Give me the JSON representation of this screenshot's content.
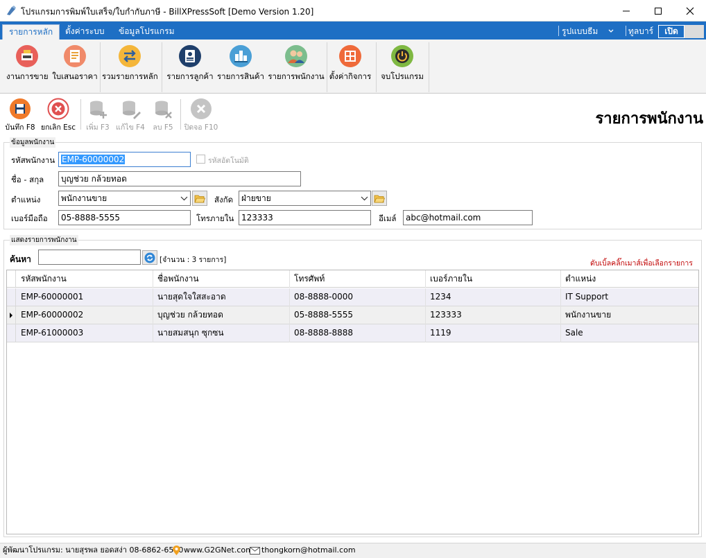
{
  "window": {
    "title": "โปรแกรมการพิมพ์ใบเสร็จ/ใบกำกับภาษี - BillXPressSoft [Demo Version 1.20]",
    "minimize_icon": "minimize-icon",
    "maximize_icon": "maximize-icon",
    "close_icon": "close-icon"
  },
  "menu": {
    "tabs": [
      {
        "label": "รายการหลัก"
      },
      {
        "label": "ตั้งค่าระบบ"
      },
      {
        "label": "ข้อมูลโปรแกรม"
      }
    ],
    "theme_label": "รูปแบบธีม",
    "toolbar_label": "ทูลบาร์",
    "toggle_on_label": "เปิด"
  },
  "ribbon": {
    "buttons": [
      {
        "label": "งานการขาย",
        "icon": "cash-register-icon"
      },
      {
        "label": "ใบเสนอราคา",
        "icon": "quotation-icon"
      },
      {
        "label": "รวมรายการหลัก",
        "icon": "transfer-arrows-icon"
      },
      {
        "label": "รายการลูกค้า",
        "icon": "customer-card-icon"
      },
      {
        "label": "รายการสินค้า",
        "icon": "products-icon"
      },
      {
        "label": "รายการพนักงาน",
        "icon": "employees-icon"
      },
      {
        "label": "ตั้งค่ากิจการ",
        "icon": "business-settings-icon"
      },
      {
        "label": "จบโปรแกรม",
        "icon": "power-icon"
      }
    ]
  },
  "toolbar": {
    "save": "บันทึก F8",
    "cancel": "ยกเลิก Esc",
    "add": "เพิ่ม F3",
    "edit": "แก้ไข F4",
    "delete": "ลบ F5",
    "close": "ปิดจอ F10"
  },
  "page_title": "รายการพนักงาน",
  "form": {
    "group_title": "ข้อมูลพนักงาน",
    "employee_id_label": "รหัสพนักงาน",
    "employee_id_value": "EMP-60000002",
    "auto_code_label": "รหัสอัตโนมัติ",
    "name_label": "ชื่อ - สกุล",
    "name_value": "บุญช่วย กล้วยทอด",
    "position_label": "ตำแหน่ง",
    "position_value": "พนักงานขาย",
    "department_label": "สังกัด",
    "department_value": "ฝ่ายขาย",
    "mobile_label": "เบอร์มือถือ",
    "mobile_value": "05-8888-5555",
    "extension_label": "โทรภายใน",
    "extension_value": "123333",
    "email_label": "อีเมล์",
    "email_value": "abc@hotmail.com"
  },
  "list": {
    "group_title": "แสดงรายการพนักงาน",
    "search_label": "ค้นหา",
    "search_value": "",
    "count_text": "[จำนวน : 3 รายการ]",
    "hint": "ดับเบิ้ลคลิ๊กเมาส์เพื่อเลือกรายการ",
    "columns": [
      "รหัสพนักงาน",
      "ชื่อพนักงาน",
      "โทรศัพท์",
      "เบอร์ภายใน",
      "ตำแหน่ง"
    ],
    "rows": [
      [
        "EMP-60000001",
        "นายสุดใจใสสะอาด",
        "08-8888-0000",
        "1234",
        "IT Support"
      ],
      [
        "EMP-60000002",
        "บุญช่วย กล้วยทอด",
        "05-8888-5555",
        "123333",
        "พนักงานขาย"
      ],
      [
        "EMP-61000003",
        "นายสมสนุก ซุกซน",
        "08-8888-8888",
        "1119",
        "Sale"
      ]
    ],
    "selected_row": 1
  },
  "status": {
    "developer": "ผู้พัฒนาโปรแกรม: นายสุรพล ยอดสง่า 08-6862-6560",
    "website": "www.G2GNet.com",
    "email": "thongkorn@hotmail.com"
  },
  "colors": {
    "menubar": "#1e6fc4",
    "hint": "#c00000",
    "selected_text": "#3399ff"
  }
}
